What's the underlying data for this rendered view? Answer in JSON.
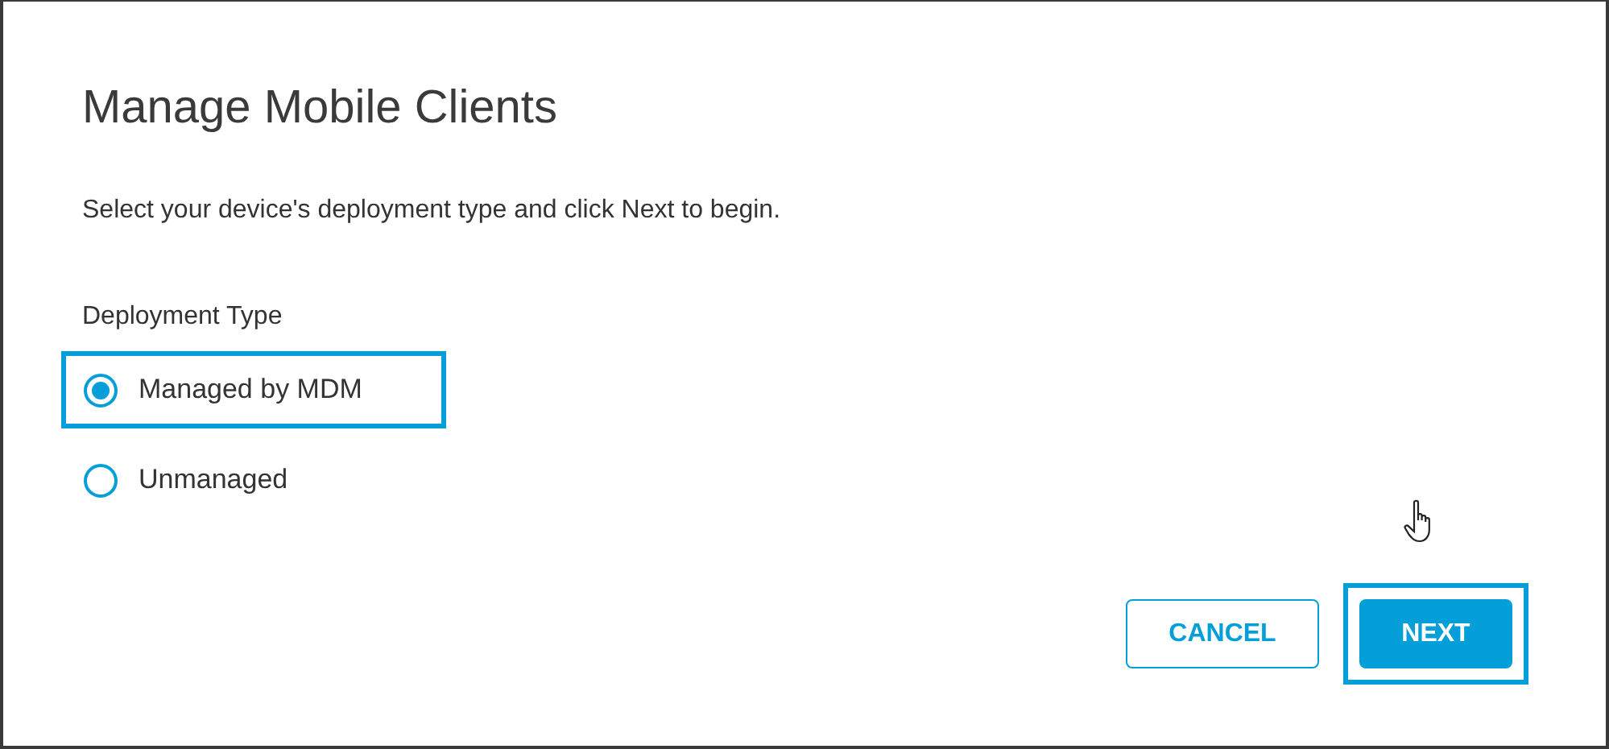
{
  "dialog": {
    "title": "Manage Mobile Clients",
    "instruction": "Select your device's deployment type and click Next to begin.",
    "deployment_type": {
      "label": "Deployment Type",
      "options": [
        {
          "label": "Managed by MDM",
          "selected": true,
          "highlighted": true
        },
        {
          "label": "Unmanaged",
          "selected": false,
          "highlighted": false
        }
      ]
    },
    "buttons": [
      {
        "label": "CANCEL",
        "kind": "secondary",
        "highlighted": false
      },
      {
        "label": "NEXT",
        "kind": "primary",
        "highlighted": true
      }
    ]
  }
}
